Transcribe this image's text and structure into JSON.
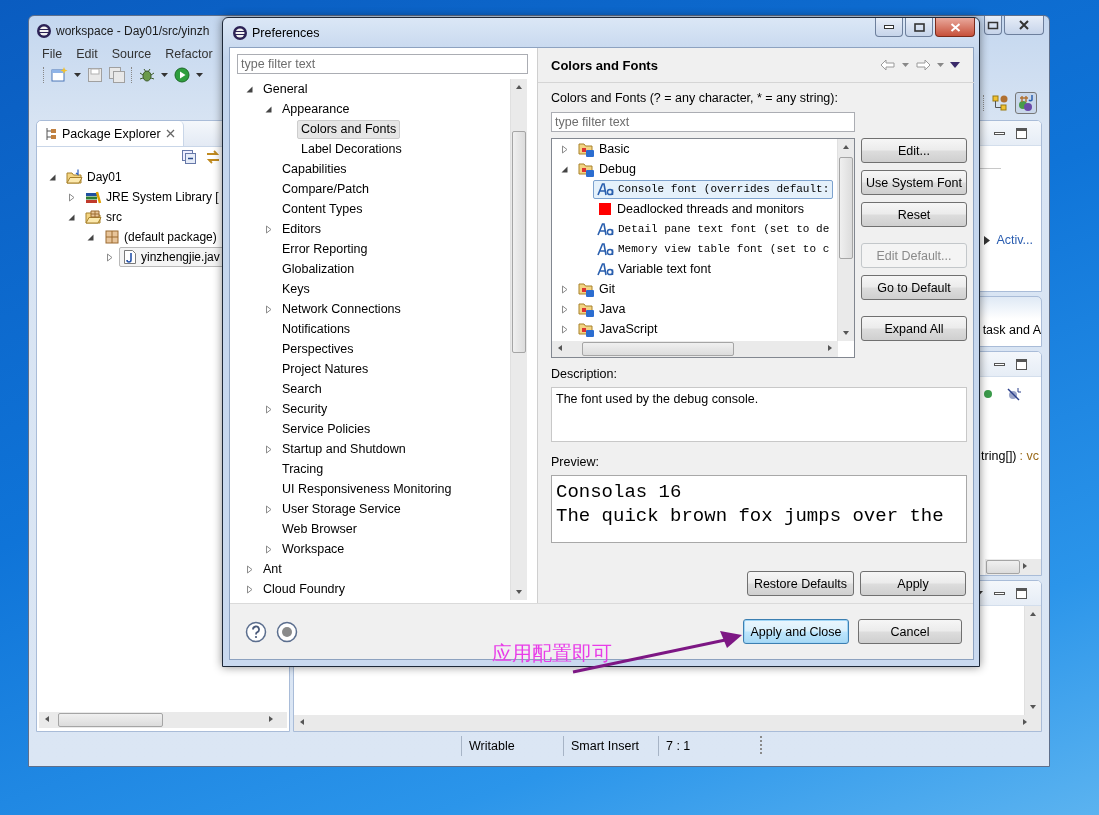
{
  "eclipse_window": {
    "title": "workspace - Day01/src/yinzh",
    "menu": [
      "File",
      "Edit",
      "Source",
      "Refactor"
    ],
    "package_explorer": {
      "title": "Package Explorer",
      "tree": [
        {
          "label": "Day01",
          "kind": "project",
          "expanded": true,
          "selected": false,
          "children": [
            {
              "label": "JRE System Library [",
              "kind": "library",
              "expanded": false,
              "selected": false
            },
            {
              "label": "src",
              "kind": "source-folder",
              "expanded": true,
              "selected": false,
              "children": [
                {
                  "label": "(default package)",
                  "kind": "package",
                  "expanded": true,
                  "selected": false,
                  "children": [
                    {
                      "label": "yinzhengjie.jav",
                      "kind": "java-file",
                      "expanded": false,
                      "selected": true
                    }
                  ]
                }
              ]
            }
          ]
        }
      ]
    },
    "side_views": {
      "link": "Activ...",
      "task_text": "task and A",
      "signature": "tring[])",
      "return_type": ": vc"
    },
    "status_bar": [
      "Writable",
      "Smart Insert",
      "7 : 1"
    ]
  },
  "preferences": {
    "title": "Preferences",
    "filter_placeholder": "type filter text",
    "tree": [
      {
        "label": "General",
        "expanded": true,
        "selected": false,
        "children": [
          {
            "label": "Appearance",
            "expanded": true,
            "selected": false,
            "children": [
              {
                "label": "Colors and Fonts",
                "selected": true
              },
              {
                "label": "Label Decorations",
                "selected": false
              }
            ]
          },
          {
            "label": "Capabilities",
            "selected": false
          },
          {
            "label": "Compare/Patch",
            "selected": false
          },
          {
            "label": "Content Types",
            "selected": false
          },
          {
            "label": "Editors",
            "expanded": false,
            "selected": false
          },
          {
            "label": "Error Reporting",
            "selected": false
          },
          {
            "label": "Globalization",
            "selected": false
          },
          {
            "label": "Keys",
            "selected": false
          },
          {
            "label": "Network Connections",
            "expanded": false,
            "selected": false
          },
          {
            "label": "Notifications",
            "selected": false
          },
          {
            "label": "Perspectives",
            "selected": false
          },
          {
            "label": "Project Natures",
            "selected": false
          },
          {
            "label": "Search",
            "selected": false
          },
          {
            "label": "Security",
            "expanded": false,
            "selected": false
          },
          {
            "label": "Service Policies",
            "selected": false
          },
          {
            "label": "Startup and Shutdown",
            "expanded": false,
            "selected": false
          },
          {
            "label": "Tracing",
            "selected": false
          },
          {
            "label": "UI Responsiveness Monitoring",
            "selected": false
          },
          {
            "label": "User Storage Service",
            "expanded": false,
            "selected": false
          },
          {
            "label": "Web Browser",
            "selected": false
          },
          {
            "label": "Workspace",
            "expanded": false,
            "selected": false
          }
        ]
      },
      {
        "label": "Ant",
        "expanded": false,
        "selected": false
      },
      {
        "label": "Cloud Foundry",
        "expanded": false,
        "selected": false
      }
    ],
    "page": {
      "title": "Colors and Fonts",
      "filter_label": "Colors and Fonts (? = any character, * = any string):",
      "filter_placeholder": "type filter text",
      "items": [
        {
          "label": "Basic",
          "kind": "category",
          "expanded": false,
          "selected": false
        },
        {
          "label": "Debug",
          "kind": "category",
          "expanded": true,
          "selected": false,
          "children": [
            {
              "label": "Console font (overrides default:",
              "kind": "fixedfont",
              "selected": true
            },
            {
              "label": "Deadlocked threads and monitors",
              "kind": "color",
              "color": "#ff0000",
              "selected": false
            },
            {
              "label": "Detail pane text font (set to de",
              "kind": "fixedfont",
              "selected": false
            },
            {
              "label": "Memory view table font (set to c",
              "kind": "fixedfont",
              "selected": false
            },
            {
              "label": "Variable text font",
              "kind": "font",
              "selected": false
            }
          ]
        },
        {
          "label": "Git",
          "kind": "category",
          "expanded": false,
          "selected": false
        },
        {
          "label": "Java",
          "kind": "category",
          "expanded": false,
          "selected": false
        },
        {
          "label": "JavaScript",
          "kind": "category",
          "expanded": false,
          "selected": false
        }
      ],
      "buttons": [
        {
          "label": "Edit...",
          "disabled": false
        },
        {
          "label": "Use System Font",
          "disabled": false
        },
        {
          "label": "Reset",
          "disabled": false
        },
        {
          "label": "Edit Default...",
          "disabled": true
        },
        {
          "label": "Go to Default",
          "disabled": false
        },
        {
          "label": "Expand All",
          "disabled": false
        }
      ],
      "description_label": "Description:",
      "description": "The font used by the debug console.",
      "preview_label": "Preview:",
      "preview_lines": [
        "Consolas 16",
        "The quick brown fox jumps over the"
      ],
      "page_buttons": [
        "Restore Defaults",
        "Apply"
      ]
    },
    "footer_buttons": [
      {
        "label": "Apply and Close",
        "default": true
      },
      {
        "label": "Cancel",
        "default": false
      }
    ]
  },
  "annotation": {
    "text": "应用配置即可"
  }
}
